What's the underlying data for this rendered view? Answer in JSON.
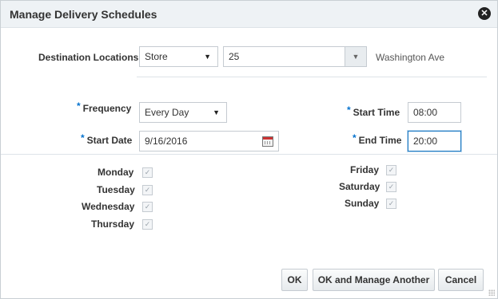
{
  "dialog": {
    "title": "Manage Delivery Schedules",
    "close_icon": "close-icon"
  },
  "destination": {
    "label": "Destination Locations",
    "type_value": "Store",
    "location_value": "25",
    "location_name": "Washington Ave"
  },
  "frequency": {
    "required_mark": "*",
    "label": "Frequency",
    "value": "Every Day"
  },
  "start_date": {
    "required_mark": "*",
    "label": "Start Date",
    "value": "9/16/2016",
    "icon": "calendar-icon"
  },
  "start_time": {
    "required_mark": "*",
    "label": "Start Time",
    "value": "08:00"
  },
  "end_time": {
    "required_mark": "*",
    "label": "End Time",
    "value": "20:00"
  },
  "days": {
    "left": [
      {
        "label": "Monday",
        "checked": true
      },
      {
        "label": "Tuesday",
        "checked": true
      },
      {
        "label": "Wednesday",
        "checked": true
      },
      {
        "label": "Thursday",
        "checked": true
      }
    ],
    "right": [
      {
        "label": "Friday",
        "checked": true
      },
      {
        "label": "Saturday",
        "checked": true
      },
      {
        "label": "Sunday",
        "checked": true
      }
    ],
    "check_glyph": "✓"
  },
  "buttons": {
    "ok": "OK",
    "ok_manage_another": "OK and Manage Another",
    "cancel": "Cancel"
  }
}
